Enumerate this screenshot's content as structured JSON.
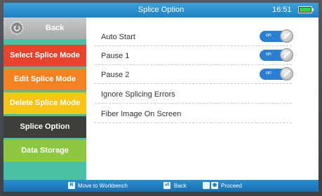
{
  "header": {
    "title": "Splice Option",
    "time": "16:51",
    "battery_icon": "battery-icon",
    "battery_level_pct": 100
  },
  "sidebar": {
    "back": {
      "label": "Back",
      "icon": "back-arrow-icon"
    },
    "items": [
      {
        "label": "Select Splice Mode",
        "color": "#e7432d"
      },
      {
        "label": "Edit Splice Mode",
        "color": "#f58220"
      },
      {
        "label": "Delete Splice Mode",
        "color": "#f6c414"
      },
      {
        "label": "Splice Option",
        "color": "#3f3f3a",
        "selected": true
      },
      {
        "label": "Data Storage",
        "color": "#8dc63f"
      }
    ],
    "background_color": "#49bfa4"
  },
  "settings": [
    {
      "label": "Auto Start",
      "toggle": "on"
    },
    {
      "label": "Pause 1",
      "toggle": "on"
    },
    {
      "label": "Pause 2",
      "toggle": "on"
    },
    {
      "label": "Ignore Splicing Errors"
    },
    {
      "label": "Fiber Image On Screen"
    }
  ],
  "footer": {
    "hints": [
      {
        "key": "R",
        "label": "Move to Workbench"
      },
      {
        "key": "⏎",
        "label": "Back"
      },
      {
        "key": "◉",
        "label": "Proceed"
      }
    ]
  },
  "colors": {
    "accent": "#1f80c2",
    "toggle_on": "#2a7fd2"
  }
}
